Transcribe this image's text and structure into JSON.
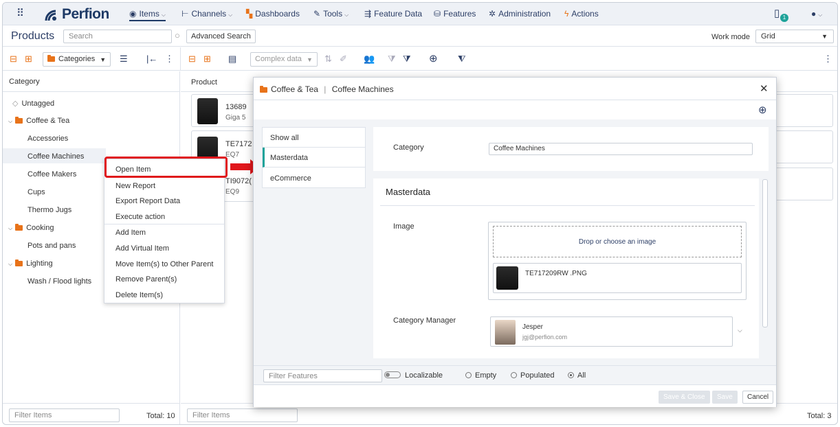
{
  "app": {
    "logo": "Perfion"
  },
  "nav": {
    "items": "Items",
    "channels": "Channels",
    "dashboards": "Dashboards",
    "tools": "Tools",
    "feature_data": "Feature Data",
    "features": "Features",
    "administration": "Administration",
    "actions": "Actions",
    "notification_count": "1"
  },
  "header": {
    "title": "Products",
    "search_placeholder": "Search",
    "advanced_search": "Advanced Search",
    "work_mode_label": "Work mode",
    "work_mode_value": "Grid"
  },
  "toolbar": {
    "categories_dropdown": "Categories",
    "complex_data_dropdown": "Complex data"
  },
  "left": {
    "column_header": "Category",
    "tree": [
      {
        "label": "Untagged"
      },
      {
        "label": "Coffee & Tea"
      },
      {
        "label": "Accessories"
      },
      {
        "label": "Coffee Machines"
      },
      {
        "label": "Coffee Makers"
      },
      {
        "label": "Cups"
      },
      {
        "label": "Thermo Jugs"
      },
      {
        "label": "Cooking"
      },
      {
        "label": "Pots and pans"
      },
      {
        "label": "Lighting"
      },
      {
        "label": "Wash / Flood lights"
      }
    ],
    "filter_placeholder": "Filter Items",
    "total": "Total: 10"
  },
  "products": {
    "column_header": "Product",
    "cards": [
      {
        "id": "13689",
        "sub": "Giga 5"
      },
      {
        "id": "TE7172",
        "sub": "EQ7"
      },
      {
        "id": "TI9072(",
        "sub": "EQ9"
      }
    ],
    "filter_placeholder": "Filter Items",
    "total": "Total: 3"
  },
  "context_menu": {
    "items": [
      "Open Item",
      "New Report",
      "Export Report Data",
      "Execute action",
      "Add Item",
      "Add Virtual Item",
      "Move Item(s) to Other Parent",
      "Remove Parent(s)",
      "Delete Item(s)"
    ]
  },
  "dialog": {
    "breadcrumb_parent": "Coffee & Tea",
    "breadcrumb_current": "Coffee Machines",
    "tabs": [
      "Show all",
      "Masterdata",
      "eCommerce"
    ],
    "category_label": "Category",
    "category_value": "Coffee Machines",
    "section_title": "Masterdata",
    "image_label": "Image",
    "drop_text": "Drop or choose an image",
    "image_file": "TE717209RW .PNG",
    "manager_label": "Category Manager",
    "manager_name": "Jesper",
    "manager_email": "jgj@perfion.com",
    "filter_features_placeholder": "Filter Features",
    "localizable": "Localizable",
    "radio_empty": "Empty",
    "radio_populated": "Populated",
    "radio_all": "All",
    "save_close": "Save & Close",
    "save": "Save",
    "cancel": "Cancel"
  },
  "colors": {
    "accent_teal": "#1fa39a",
    "folder_orange": "#e8731a",
    "highlight_red": "#e0161b",
    "nav_text": "#2c3e66"
  }
}
